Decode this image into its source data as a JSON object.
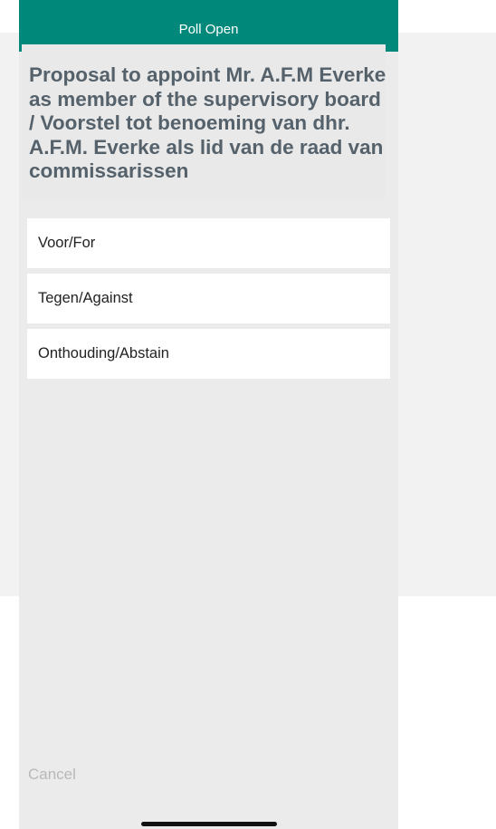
{
  "header": {
    "title": "Poll Open"
  },
  "poll": {
    "question": "Proposal to appoint Mr. A.F.M Everke as member of the supervisory board /  Voorstel tot benoeming van dhr. A.F.M. Everke als lid van de raad van commissarissen",
    "options": [
      {
        "label": "Voor/For"
      },
      {
        "label": "Tegen/Against"
      },
      {
        "label": "Onthouding/Abstain"
      }
    ]
  },
  "footer": {
    "cancel_label": "Cancel"
  },
  "colors": {
    "header_bg": "#00897b",
    "question_text": "#56626b",
    "panel_bg": "#ebebeb"
  }
}
